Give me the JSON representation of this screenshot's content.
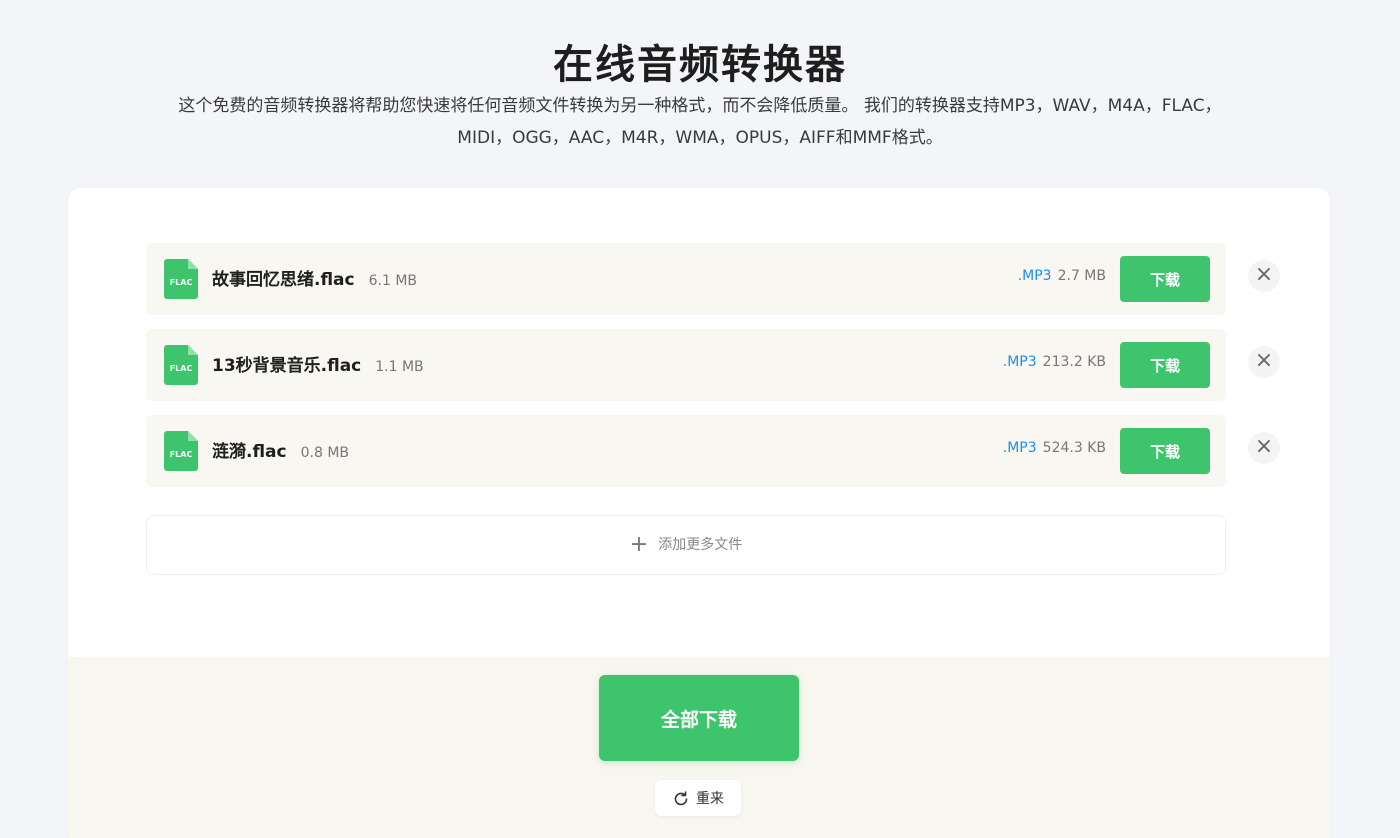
{
  "header": {
    "title": "在线音频转换器",
    "subtitle_line1": "这个免费的音频转换器将帮助您快速将任何音频文件转换为另一种格式，而不会降低质量。 我们的转换器支持MP3，WAV，M4A，FLAC，",
    "subtitle_line2": "MIDI，OGG，AAC，M4R，WMA，OPUS，AIFF和MMF格式。"
  },
  "files": [
    {
      "icon": "flac-file-icon",
      "icon_label": "FLAC",
      "name": "故事回忆思绪.flac",
      "size": "6.1 MB",
      "out_format": ".MP3",
      "out_size": "2.7 MB",
      "download_label": "下载"
    },
    {
      "icon": "flac-file-icon",
      "icon_label": "FLAC",
      "name": "13秒背景音乐.flac",
      "size": "1.1 MB",
      "out_format": ".MP3",
      "out_size": "213.2 KB",
      "download_label": "下载"
    },
    {
      "icon": "flac-file-icon",
      "icon_label": "FLAC",
      "name": "涟漪.flac",
      "size": "0.8 MB",
      "out_format": ".MP3",
      "out_size": "524.3 KB",
      "download_label": "下载"
    }
  ],
  "close_icon": "×",
  "add_more": {
    "icon": "plus-icon",
    "label": "添加更多文件"
  },
  "actions": {
    "download_all_label": "全部下载",
    "restart_icon": "refresh-icon",
    "restart_label": "重来"
  },
  "colors": {
    "accent_green": "#3ec46d",
    "format_blue": "#1e8ee8",
    "file_icon_green": "#3ec46d"
  }
}
